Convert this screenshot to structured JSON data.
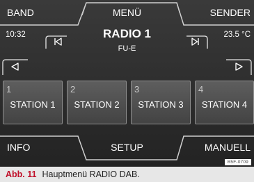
{
  "header_tabs": {
    "band": "BAND",
    "menu": "MENÜ",
    "sender": "SENDER"
  },
  "status": {
    "clock": "10:32",
    "temperature": "23.5 °C"
  },
  "station": {
    "name": "RADIO 1",
    "ensemble": "FU-E"
  },
  "presets": [
    {
      "number": "1",
      "label": "STATION 1"
    },
    {
      "number": "2",
      "label": "STATION 2"
    },
    {
      "number": "3",
      "label": "STATION 3"
    },
    {
      "number": "4",
      "label": "STATION 4"
    }
  ],
  "footer_tabs": {
    "info": "INFO",
    "setup": "SETUP",
    "manuell": "MANUELL"
  },
  "reference_code": "B5F-0709",
  "caption": {
    "figure": "Abb. 11",
    "text": "Hauptmenü RADIO DAB."
  },
  "icons": {
    "seek_back": "skip-previous-icon",
    "seek_forward": "skip-next-icon",
    "scroll_left": "triangle-left-icon",
    "scroll_right": "triangle-right-icon"
  },
  "colors": {
    "screen_bg": "#2b2b2b",
    "preset_border": "#8f8f8f",
    "caption_accent": "#c0102a",
    "caption_bg": "#e7e7e7"
  }
}
